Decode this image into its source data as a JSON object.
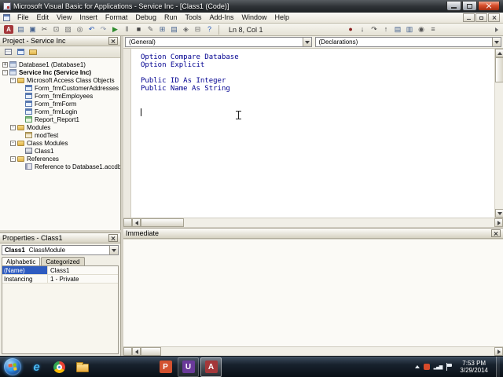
{
  "window": {
    "title": "Microsoft Visual Basic for Applications - Service Inc - [Class1 (Code)]"
  },
  "menu": {
    "items": [
      "File",
      "Edit",
      "View",
      "Insert",
      "Format",
      "Debug",
      "Run",
      "Tools",
      "Add-Ins",
      "Window",
      "Help"
    ]
  },
  "toolbar": {
    "main_icons": [
      {
        "name": "view-microsoft-access",
        "glyph": "A",
        "bg": "#a4373a"
      },
      {
        "name": "insert-object",
        "glyph": "▤",
        "color": "#44618e"
      },
      {
        "name": "save",
        "glyph": "▣",
        "color": "#44618e"
      },
      {
        "name": "cut",
        "glyph": "✂",
        "color": "#555555"
      },
      {
        "name": "copy",
        "glyph": "⊡",
        "color": "#555555"
      },
      {
        "name": "paste",
        "glyph": "▨",
        "color": "#777777"
      },
      {
        "name": "find",
        "glyph": "◎",
        "color": "#555555"
      },
      {
        "name": "undo",
        "glyph": "↶",
        "color": "#2a5bb8"
      },
      {
        "name": "redo",
        "glyph": "↷",
        "color": "#8a94a8"
      },
      {
        "name": "run",
        "glyph": "▶",
        "color": "#2e8b2e"
      },
      {
        "name": "break",
        "glyph": "‖",
        "color": "#555555"
      },
      {
        "name": "reset",
        "glyph": "■",
        "color": "#444444"
      },
      {
        "name": "design-mode",
        "glyph": "✎",
        "color": "#666666"
      },
      {
        "name": "project-explorer",
        "glyph": "⊞",
        "color": "#44618e"
      },
      {
        "name": "properties-window",
        "glyph": "▤",
        "color": "#44618e"
      },
      {
        "name": "object-browser",
        "glyph": "◈",
        "color": "#666666"
      },
      {
        "name": "toolbox",
        "glyph": "⊟",
        "color": "#666666"
      },
      {
        "name": "help",
        "glyph": "?",
        "color": "#2a5bb8"
      }
    ],
    "position_label": "Ln 8, Col 1",
    "debug_icons": [
      {
        "name": "toggle-breakpoint",
        "glyph": "●",
        "color": "#8b2020"
      },
      {
        "name": "step-into",
        "glyph": "↓",
        "color": "#444444"
      },
      {
        "name": "step-over",
        "glyph": "↷",
        "color": "#444444"
      },
      {
        "name": "step-out",
        "glyph": "↑",
        "color": "#444444"
      },
      {
        "name": "locals-window",
        "glyph": "▤",
        "color": "#44618e"
      },
      {
        "name": "immediate-window",
        "glyph": "▥",
        "color": "#44618e"
      },
      {
        "name": "watch-window",
        "glyph": "◉",
        "color": "#555555"
      },
      {
        "name": "call-stack",
        "glyph": "≡",
        "color": "#555555"
      }
    ]
  },
  "project": {
    "title": "Project - Service Inc",
    "items": [
      {
        "label": "Database1 (Database1)",
        "indent": 0,
        "expand": "+",
        "icon": "project"
      },
      {
        "label": "Service Inc (Service Inc)",
        "indent": 0,
        "expand": "-",
        "icon": "project",
        "bold": true
      },
      {
        "label": "Microsoft Access Class Objects",
        "indent": 1,
        "expand": "-",
        "icon": "folder"
      },
      {
        "label": "Form_frmCustomerAddresses",
        "indent": 2,
        "icon": "form"
      },
      {
        "label": "Form_frmEmployees",
        "indent": 2,
        "icon": "form"
      },
      {
        "label": "Form_frmForm",
        "indent": 2,
        "icon": "form"
      },
      {
        "label": "Form_frmLogin",
        "indent": 2,
        "icon": "form"
      },
      {
        "label": "Report_Report1",
        "indent": 2,
        "icon": "report"
      },
      {
        "label": "Modules",
        "indent": 1,
        "expand": "-",
        "icon": "folder"
      },
      {
        "label": "modTest",
        "indent": 2,
        "icon": "module"
      },
      {
        "label": "Class Modules",
        "indent": 1,
        "expand": "-",
        "icon": "folder"
      },
      {
        "label": "Class1",
        "indent": 2,
        "icon": "class"
      },
      {
        "label": "References",
        "indent": 1,
        "expand": "-",
        "icon": "folder"
      },
      {
        "label": "Reference to Database1.accdb",
        "indent": 2,
        "icon": "reference"
      }
    ]
  },
  "properties": {
    "title": "Properties - Class1",
    "object_name": "Class1",
    "object_type": "ClassModule",
    "tabs": [
      "Alphabetic",
      "Categorized"
    ],
    "active_tab": "Alphabetic",
    "rows": [
      {
        "name": "(Name)",
        "value": "Class1",
        "selected": true
      },
      {
        "name": "Instancing",
        "value": "1 - Private",
        "selected": false
      }
    ]
  },
  "code": {
    "combo_left": "(General)",
    "combo_right": "(Declarations)",
    "text_color": "#000090",
    "lines": [
      "Option Compare Database",
      "Option Explicit",
      "",
      "Public ID As Integer",
      "Public Name As String"
    ]
  },
  "immediate": {
    "title": "Immediate"
  },
  "taskbar": {
    "icons": [
      {
        "name": "internet-explorer",
        "label": "e"
      },
      {
        "name": "chrome"
      },
      {
        "name": "file-explorer"
      },
      {
        "name": "powerpoint",
        "label": "P",
        "gap": true
      },
      {
        "name": "u-app",
        "label": "U",
        "open": true
      },
      {
        "name": "access",
        "label": "A",
        "active": true
      }
    ],
    "tray": [
      {
        "name": "show-hidden-icons"
      },
      {
        "name": "tray-alert"
      },
      {
        "name": "network",
        "glyph": "▂▄▆"
      },
      {
        "name": "action-center-flag"
      }
    ],
    "clock": {
      "time": "7:53 PM",
      "date": "3/29/2014"
    }
  }
}
